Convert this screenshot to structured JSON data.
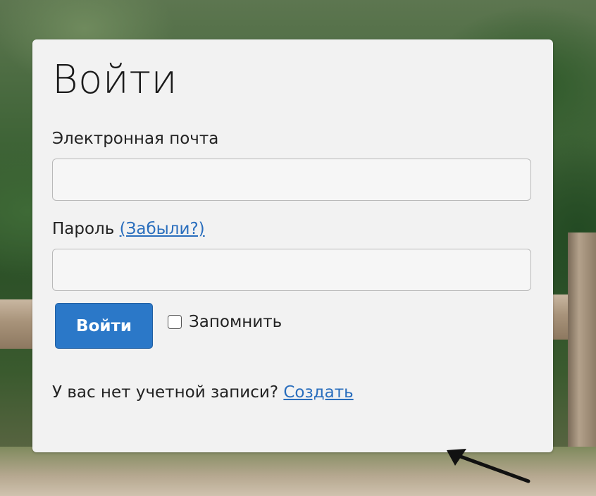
{
  "form": {
    "title": "Войти",
    "email_label": "Электронная почта",
    "email_value": "",
    "password_label": "Пароль",
    "forgot_link": "(Забыли?)",
    "password_value": "",
    "submit_label": "Войти",
    "remember_label": "Запомнить",
    "remember_checked": false,
    "no_account_text": "У вас нет учетной записи?",
    "create_link": "Создать"
  },
  "colors": {
    "card_background": "#f2f2f2",
    "primary_button": "#2b78c8",
    "link": "#2a6ebd"
  },
  "icons": {
    "annotation": "arrow-pointing-left-icon",
    "remember": "checkbox-icon"
  }
}
